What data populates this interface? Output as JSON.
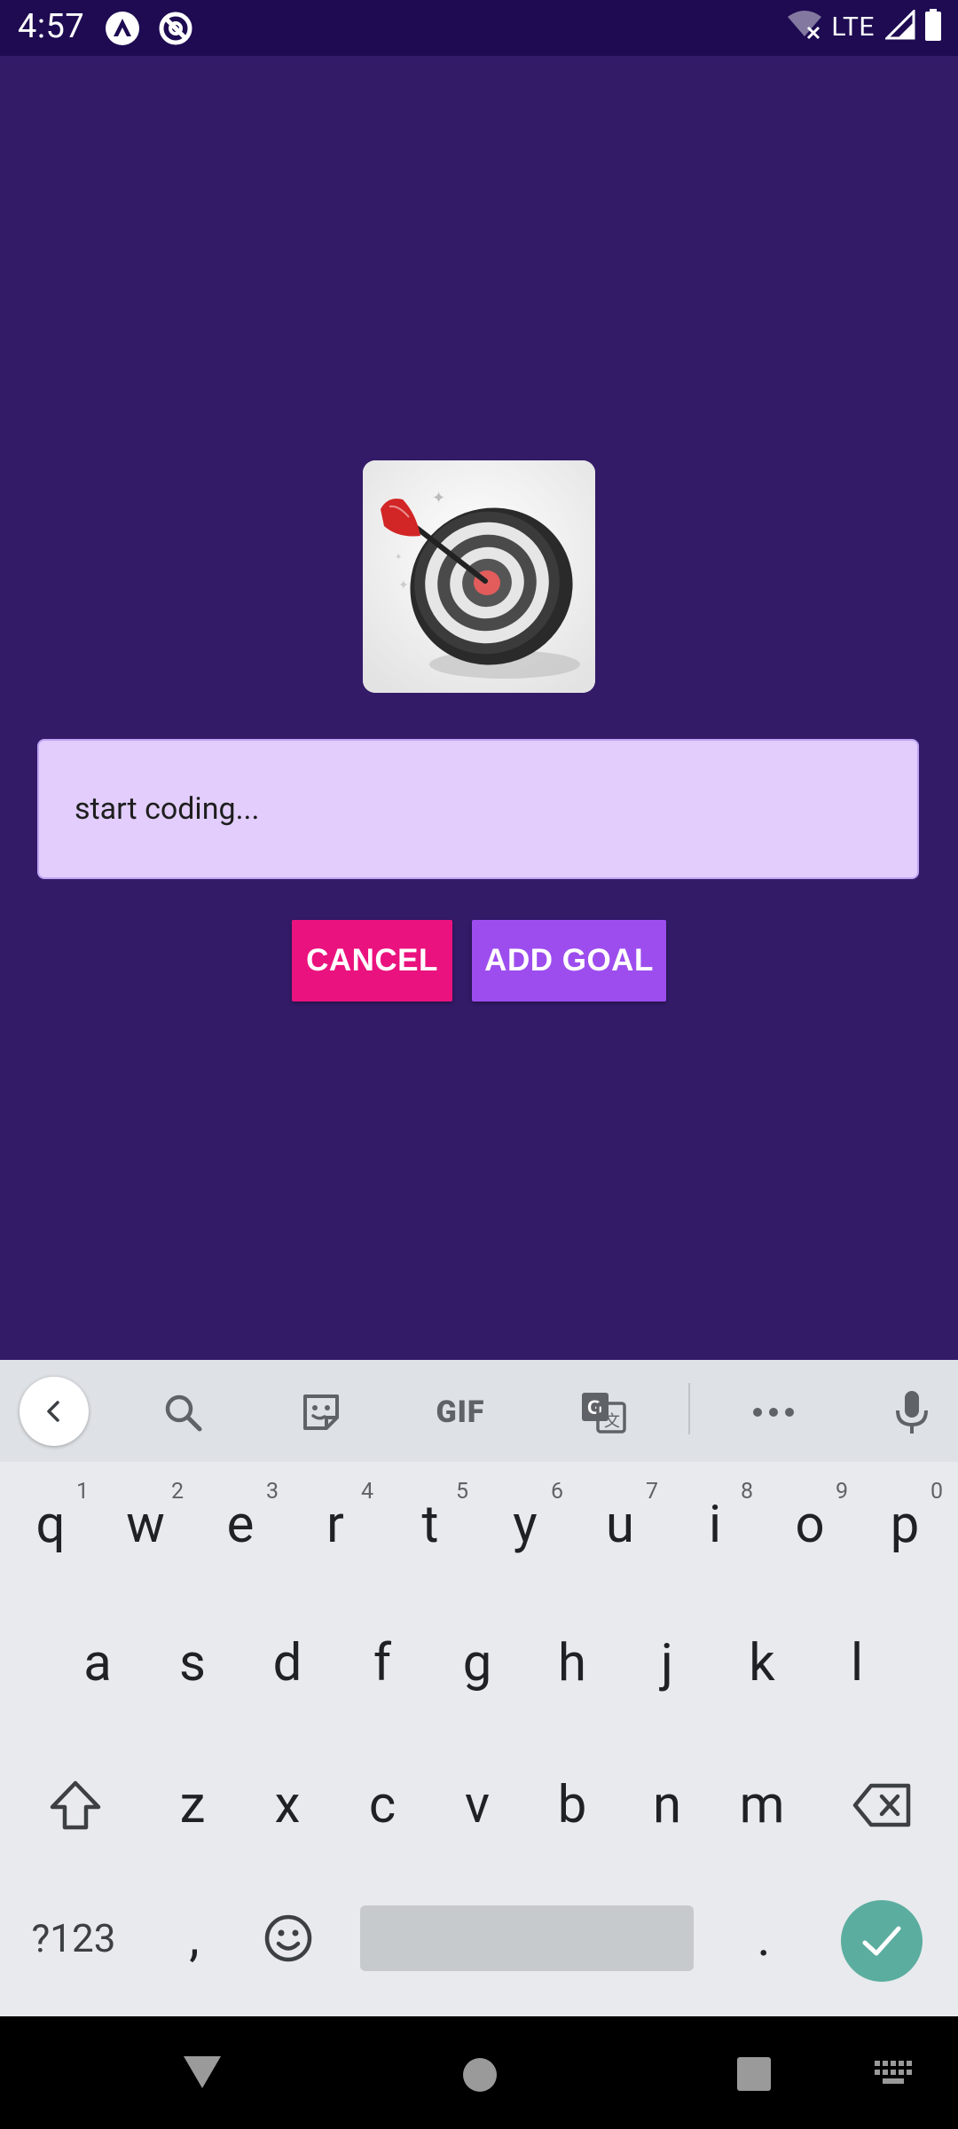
{
  "status_bar": {
    "time": "4:57",
    "network": "LTE",
    "icons": [
      "app-a-icon",
      "app-blocked-icon",
      "wifi-off-icon",
      "signal-icon",
      "battery-icon"
    ]
  },
  "app": {
    "background_color": "#331b68",
    "goal_image_icon": "dart-target-icon",
    "input": {
      "value": "start coding...",
      "placeholder": ""
    },
    "buttons": {
      "cancel_label": "CANCEL",
      "add_label": "ADD GOAL"
    },
    "colors": {
      "cancel": "#ea127e",
      "add": "#9d4dee",
      "input_bg": "#e2cdfc"
    }
  },
  "keyboard": {
    "toolbar": {
      "back_icon": "chevron-left-icon",
      "search_icon": "search-icon",
      "sticker_icon": "sticker-icon",
      "gif_label": "GIF",
      "translate_icon": "translate-icon",
      "more_icon": "more-icon",
      "mic_icon": "mic-icon"
    },
    "row1": [
      {
        "key": "q",
        "hint": "1"
      },
      {
        "key": "w",
        "hint": "2"
      },
      {
        "key": "e",
        "hint": "3"
      },
      {
        "key": "r",
        "hint": "4"
      },
      {
        "key": "t",
        "hint": "5"
      },
      {
        "key": "y",
        "hint": "6"
      },
      {
        "key": "u",
        "hint": "7"
      },
      {
        "key": "i",
        "hint": "8"
      },
      {
        "key": "o",
        "hint": "9"
      },
      {
        "key": "p",
        "hint": "0"
      }
    ],
    "row2": [
      "a",
      "s",
      "d",
      "f",
      "g",
      "h",
      "j",
      "k",
      "l"
    ],
    "row3": [
      "z",
      "x",
      "c",
      "v",
      "b",
      "n",
      "m"
    ],
    "bottom": {
      "symbols_label": "?123",
      "comma": ",",
      "period": "."
    }
  }
}
